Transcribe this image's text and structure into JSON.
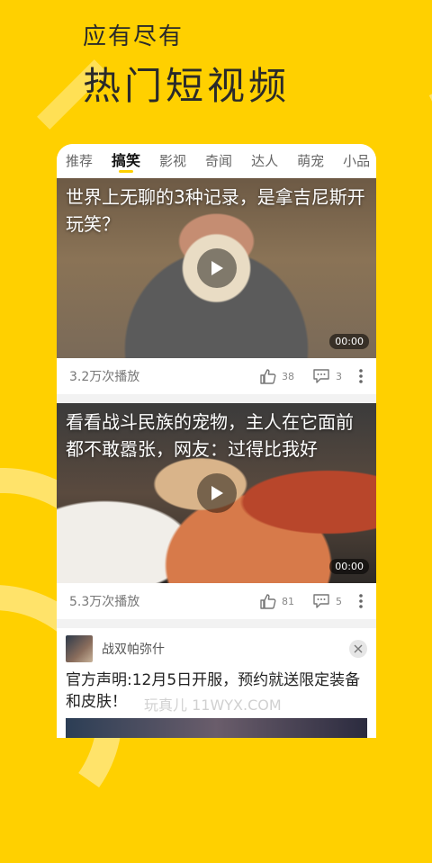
{
  "hero": {
    "subtitle": "应有尽有",
    "title": "热门短视频"
  },
  "tabs": [
    {
      "label": "推荐",
      "active": false
    },
    {
      "label": "搞笑",
      "active": true
    },
    {
      "label": "影视",
      "active": false
    },
    {
      "label": "奇闻",
      "active": false
    },
    {
      "label": "达人",
      "active": false
    },
    {
      "label": "萌宠",
      "active": false
    },
    {
      "label": "小品",
      "active": false
    }
  ],
  "videos": [
    {
      "title": "世界上无聊的3种记录，是拿吉尼斯开玩笑？",
      "duration": "00:00",
      "plays": "3.2万次播放",
      "likes": "38",
      "comments": "3"
    },
    {
      "title": "看看战斗民族的宠物，主人在它面前都不敢嚣张，网友：过得比我好",
      "duration": "00:00",
      "plays": "5.3万次播放",
      "likes": "81",
      "comments": "5"
    }
  ],
  "ad": {
    "name": "战双帕弥什",
    "text": "官方声明:12月5日开服，预约就送限定装备和皮肤！"
  },
  "watermark": "玩真儿 11WYX.COM",
  "colors": {
    "background": "#FFD000",
    "accent": "#FFD000"
  },
  "icons": {
    "play": "play-icon",
    "like": "thumbs-up-icon",
    "comment": "comment-icon",
    "more": "more-vertical-icon",
    "close": "close-icon"
  }
}
